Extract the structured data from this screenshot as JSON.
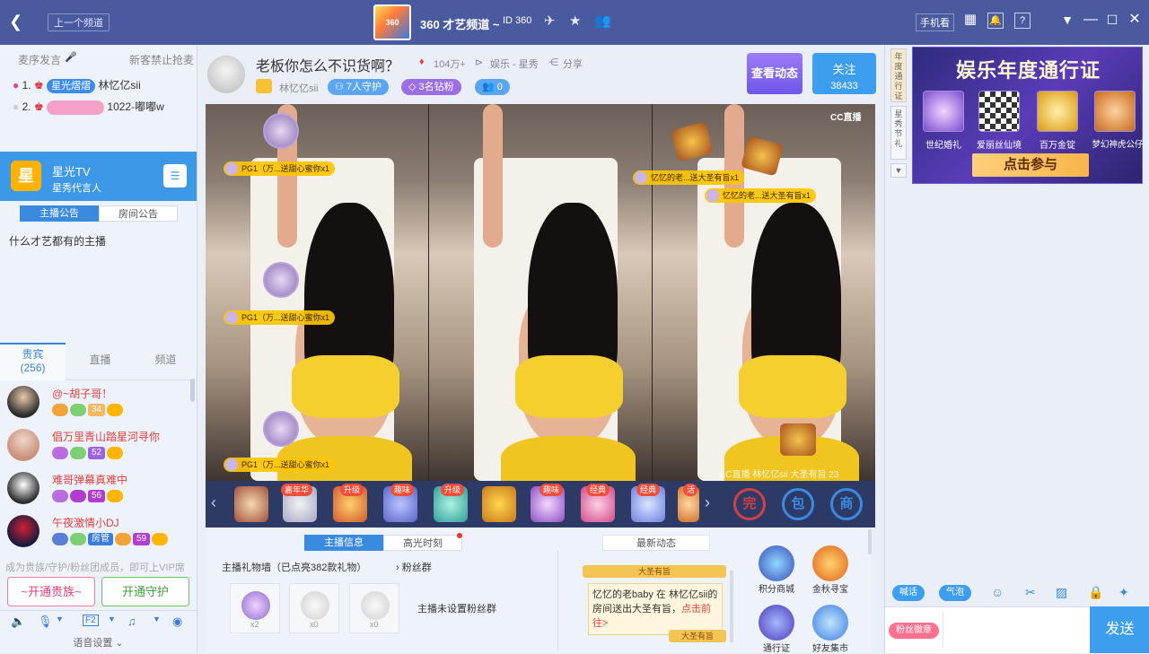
{
  "titlebar": {
    "back_icon": "chevron-left-icon",
    "prev_channel": "上一个频道",
    "channel_logo_text": "360",
    "channel_name": "360 才艺频道 ~",
    "channel_id": "ID 360",
    "phone_view": "手机看",
    "colors": {
      "bar": "#4a5a9e"
    }
  },
  "left": {
    "seat_order": "麦序发言",
    "new_guest_ban": "新客禁止抢麦",
    "ranks": [
      {
        "num": "1.",
        "badge": "星光熠熠",
        "name": "林忆亿sii"
      },
      {
        "num": "2.",
        "badge": "",
        "name": "1022-嘟嘟w"
      }
    ],
    "station": {
      "logo": "星",
      "title": "星光TV",
      "subtitle": "星秀代言人"
    },
    "notice_tabs": [
      "主播公告",
      "房间公告"
    ],
    "notice_text": "什么才艺都有的主播",
    "viewer_tabs": {
      "guests": "贵宾",
      "guests_count": "(256)",
      "live": "直播",
      "channel": "频道"
    },
    "viewers": [
      {
        "name": "@~胡子哥！",
        "level": "34"
      },
      {
        "name": "倡万里青山踏星河寻你",
        "level": "52"
      },
      {
        "name": "难哥弹幕真难中",
        "level": "56"
      },
      {
        "name": "午夜激情小DJ",
        "level": "59",
        "tag": "房管"
      }
    ],
    "vip_note": "成为贵族/守护/粉丝团成员，即可上VIP席",
    "open_noble": "~开通贵族~",
    "open_guard": "开通守护",
    "voice_settings": "语音设置 ⌄",
    "fx": "F2"
  },
  "center": {
    "room_title": "老板你怎么不识货啊？",
    "popularity": "104万+",
    "category": "娱乐 - 星秀",
    "share": "分享",
    "host_name": "林忆亿sii",
    "guards": "7人守护",
    "diamond_fans": "3名钻粉",
    "fans_count": "0",
    "view_dynamics": "查看动态",
    "follow": "关注",
    "follow_count": "38433",
    "watermark": "CC直播",
    "video_caption": "CC直播 林忆亿sii 大圣有旨 23",
    "danmu_left": "PG1（万...送甜心蜜你x1",
    "danmu_right1": "忆忆的老...送大圣有旨x1",
    "danmu_right2": "忆忆的老...送大圣有旨x1",
    "gift_tags": [
      "嘉年华",
      "升级",
      "趣味",
      "升级",
      "趣味",
      "经典",
      "经典",
      "活动"
    ],
    "big_icons": [
      "完",
      "包",
      "商"
    ],
    "info_tabs": [
      "主播信息",
      "高光时刻"
    ],
    "latest_dynamics": "最新动态",
    "gift_wall": "主播礼物墙（已点亮382款礼物）",
    "fan_group": "粉丝群",
    "no_fan_group": "主播未设置粉丝群",
    "gift_counts": [
      "x2",
      "x0",
      "x0"
    ],
    "news_user": "忆忆的老baby",
    "news_in": "在",
    "news_host": "林忆亿sii",
    "news_body": "的房间送出大圣有旨，",
    "news_link": "点击前往>",
    "news_gold_top": "大圣有旨",
    "news_gold_bottom": "大圣有旨",
    "funcs": [
      "积分商城",
      "金秋寻宝",
      "通行证",
      "好友集市"
    ]
  },
  "right": {
    "side_tabs": [
      "年度通行证",
      "星秀节礼"
    ],
    "ad_title": "娱乐年度通行证",
    "ad_items": [
      "世纪婚礼",
      "爱丽丝仙境",
      "百万金锭",
      "梦幻神虎公仔"
    ],
    "ad_cta": "点击参与",
    "chat_btns": [
      "喊话",
      "气泡"
    ],
    "fans_badge": "粉丝徽章",
    "send": "发送"
  }
}
